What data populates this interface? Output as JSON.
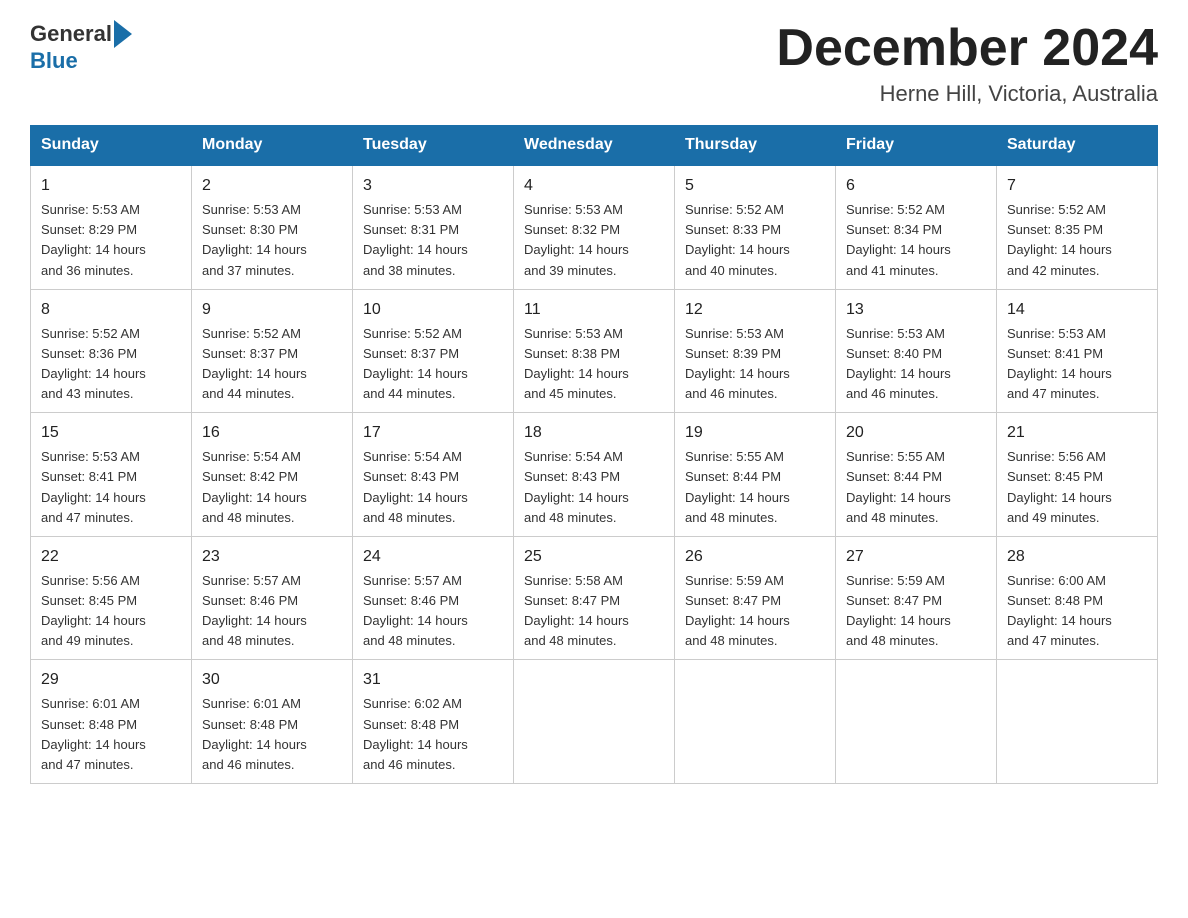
{
  "header": {
    "logo_general": "General",
    "logo_blue": "Blue",
    "title": "December 2024",
    "subtitle": "Herne Hill, Victoria, Australia"
  },
  "weekdays": [
    "Sunday",
    "Monday",
    "Tuesday",
    "Wednesday",
    "Thursday",
    "Friday",
    "Saturday"
  ],
  "weeks": [
    [
      {
        "day": "1",
        "sunrise": "5:53 AM",
        "sunset": "8:29 PM",
        "daylight": "14 hours and 36 minutes."
      },
      {
        "day": "2",
        "sunrise": "5:53 AM",
        "sunset": "8:30 PM",
        "daylight": "14 hours and 37 minutes."
      },
      {
        "day": "3",
        "sunrise": "5:53 AM",
        "sunset": "8:31 PM",
        "daylight": "14 hours and 38 minutes."
      },
      {
        "day": "4",
        "sunrise": "5:53 AM",
        "sunset": "8:32 PM",
        "daylight": "14 hours and 39 minutes."
      },
      {
        "day": "5",
        "sunrise": "5:52 AM",
        "sunset": "8:33 PM",
        "daylight": "14 hours and 40 minutes."
      },
      {
        "day": "6",
        "sunrise": "5:52 AM",
        "sunset": "8:34 PM",
        "daylight": "14 hours and 41 minutes."
      },
      {
        "day": "7",
        "sunrise": "5:52 AM",
        "sunset": "8:35 PM",
        "daylight": "14 hours and 42 minutes."
      }
    ],
    [
      {
        "day": "8",
        "sunrise": "5:52 AM",
        "sunset": "8:36 PM",
        "daylight": "14 hours and 43 minutes."
      },
      {
        "day": "9",
        "sunrise": "5:52 AM",
        "sunset": "8:37 PM",
        "daylight": "14 hours and 44 minutes."
      },
      {
        "day": "10",
        "sunrise": "5:52 AM",
        "sunset": "8:37 PM",
        "daylight": "14 hours and 44 minutes."
      },
      {
        "day": "11",
        "sunrise": "5:53 AM",
        "sunset": "8:38 PM",
        "daylight": "14 hours and 45 minutes."
      },
      {
        "day": "12",
        "sunrise": "5:53 AM",
        "sunset": "8:39 PM",
        "daylight": "14 hours and 46 minutes."
      },
      {
        "day": "13",
        "sunrise": "5:53 AM",
        "sunset": "8:40 PM",
        "daylight": "14 hours and 46 minutes."
      },
      {
        "day": "14",
        "sunrise": "5:53 AM",
        "sunset": "8:41 PM",
        "daylight": "14 hours and 47 minutes."
      }
    ],
    [
      {
        "day": "15",
        "sunrise": "5:53 AM",
        "sunset": "8:41 PM",
        "daylight": "14 hours and 47 minutes."
      },
      {
        "day": "16",
        "sunrise": "5:54 AM",
        "sunset": "8:42 PM",
        "daylight": "14 hours and 48 minutes."
      },
      {
        "day": "17",
        "sunrise": "5:54 AM",
        "sunset": "8:43 PM",
        "daylight": "14 hours and 48 minutes."
      },
      {
        "day": "18",
        "sunrise": "5:54 AM",
        "sunset": "8:43 PM",
        "daylight": "14 hours and 48 minutes."
      },
      {
        "day": "19",
        "sunrise": "5:55 AM",
        "sunset": "8:44 PM",
        "daylight": "14 hours and 48 minutes."
      },
      {
        "day": "20",
        "sunrise": "5:55 AM",
        "sunset": "8:44 PM",
        "daylight": "14 hours and 48 minutes."
      },
      {
        "day": "21",
        "sunrise": "5:56 AM",
        "sunset": "8:45 PM",
        "daylight": "14 hours and 49 minutes."
      }
    ],
    [
      {
        "day": "22",
        "sunrise": "5:56 AM",
        "sunset": "8:45 PM",
        "daylight": "14 hours and 49 minutes."
      },
      {
        "day": "23",
        "sunrise": "5:57 AM",
        "sunset": "8:46 PM",
        "daylight": "14 hours and 48 minutes."
      },
      {
        "day": "24",
        "sunrise": "5:57 AM",
        "sunset": "8:46 PM",
        "daylight": "14 hours and 48 minutes."
      },
      {
        "day": "25",
        "sunrise": "5:58 AM",
        "sunset": "8:47 PM",
        "daylight": "14 hours and 48 minutes."
      },
      {
        "day": "26",
        "sunrise": "5:59 AM",
        "sunset": "8:47 PM",
        "daylight": "14 hours and 48 minutes."
      },
      {
        "day": "27",
        "sunrise": "5:59 AM",
        "sunset": "8:47 PM",
        "daylight": "14 hours and 48 minutes."
      },
      {
        "day": "28",
        "sunrise": "6:00 AM",
        "sunset": "8:48 PM",
        "daylight": "14 hours and 47 minutes."
      }
    ],
    [
      {
        "day": "29",
        "sunrise": "6:01 AM",
        "sunset": "8:48 PM",
        "daylight": "14 hours and 47 minutes."
      },
      {
        "day": "30",
        "sunrise": "6:01 AM",
        "sunset": "8:48 PM",
        "daylight": "14 hours and 46 minutes."
      },
      {
        "day": "31",
        "sunrise": "6:02 AM",
        "sunset": "8:48 PM",
        "daylight": "14 hours and 46 minutes."
      },
      null,
      null,
      null,
      null
    ]
  ],
  "labels": {
    "sunrise": "Sunrise:",
    "sunset": "Sunset:",
    "daylight": "Daylight:"
  }
}
